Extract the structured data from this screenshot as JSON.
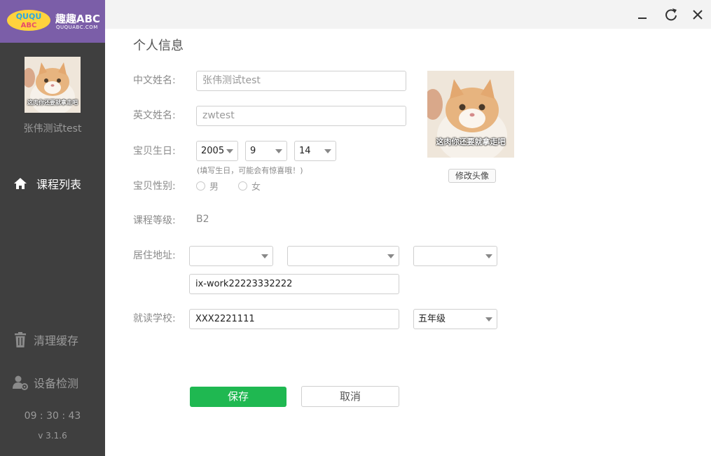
{
  "brand": {
    "logo_text": "QUQU ABC",
    "name": "趣趣ABC",
    "url": "QUQUABC.COM",
    "color": "#7b5ea8"
  },
  "sidebar": {
    "user_name": "张伟测试test",
    "avatar_caption": "这肉你还要就拿走吧",
    "nav": {
      "courses": {
        "label": "课程列表",
        "icon": "home-icon"
      },
      "clear_cache": {
        "label": "清理缓存",
        "icon": "trash-icon"
      },
      "device_check": {
        "label": "设备检测",
        "icon": "user-gear-icon"
      }
    },
    "clock": "09 : 30 : 43",
    "version": "v 3.1.6"
  },
  "window_controls": {
    "minimize": "minimize-icon",
    "refresh": "refresh-icon",
    "close": "close-icon"
  },
  "form": {
    "title": "个人信息",
    "chinese_name": {
      "label": "中文姓名:",
      "value": "张伟测试test"
    },
    "english_name": {
      "label": "英文姓名:",
      "value": "zwtest"
    },
    "birthday": {
      "label": "宝贝生日:",
      "year": "2005",
      "month": "9",
      "day": "14",
      "hint": "(填写生日，可能会有惊喜哦！)"
    },
    "gender": {
      "label": "宝贝性别:",
      "options": [
        "男",
        "女"
      ]
    },
    "level": {
      "label": "课程等级:",
      "value": "B2"
    },
    "address": {
      "label": "居住地址:",
      "province": "",
      "city": "",
      "district": "",
      "detail": "ix-work22223332222"
    },
    "school": {
      "label": "就读学校:",
      "value": "XXX2221111",
      "grade": "五年级"
    },
    "avatar_caption": "这肉你还要就拿走吧",
    "change_avatar_label": "修改头像",
    "save_label": "保存",
    "cancel_label": "取消"
  },
  "colors": {
    "sidebar_bg": "#3f3f3f",
    "save_green": "#1fb851",
    "titlebar_bg": "#f3f3f3"
  }
}
